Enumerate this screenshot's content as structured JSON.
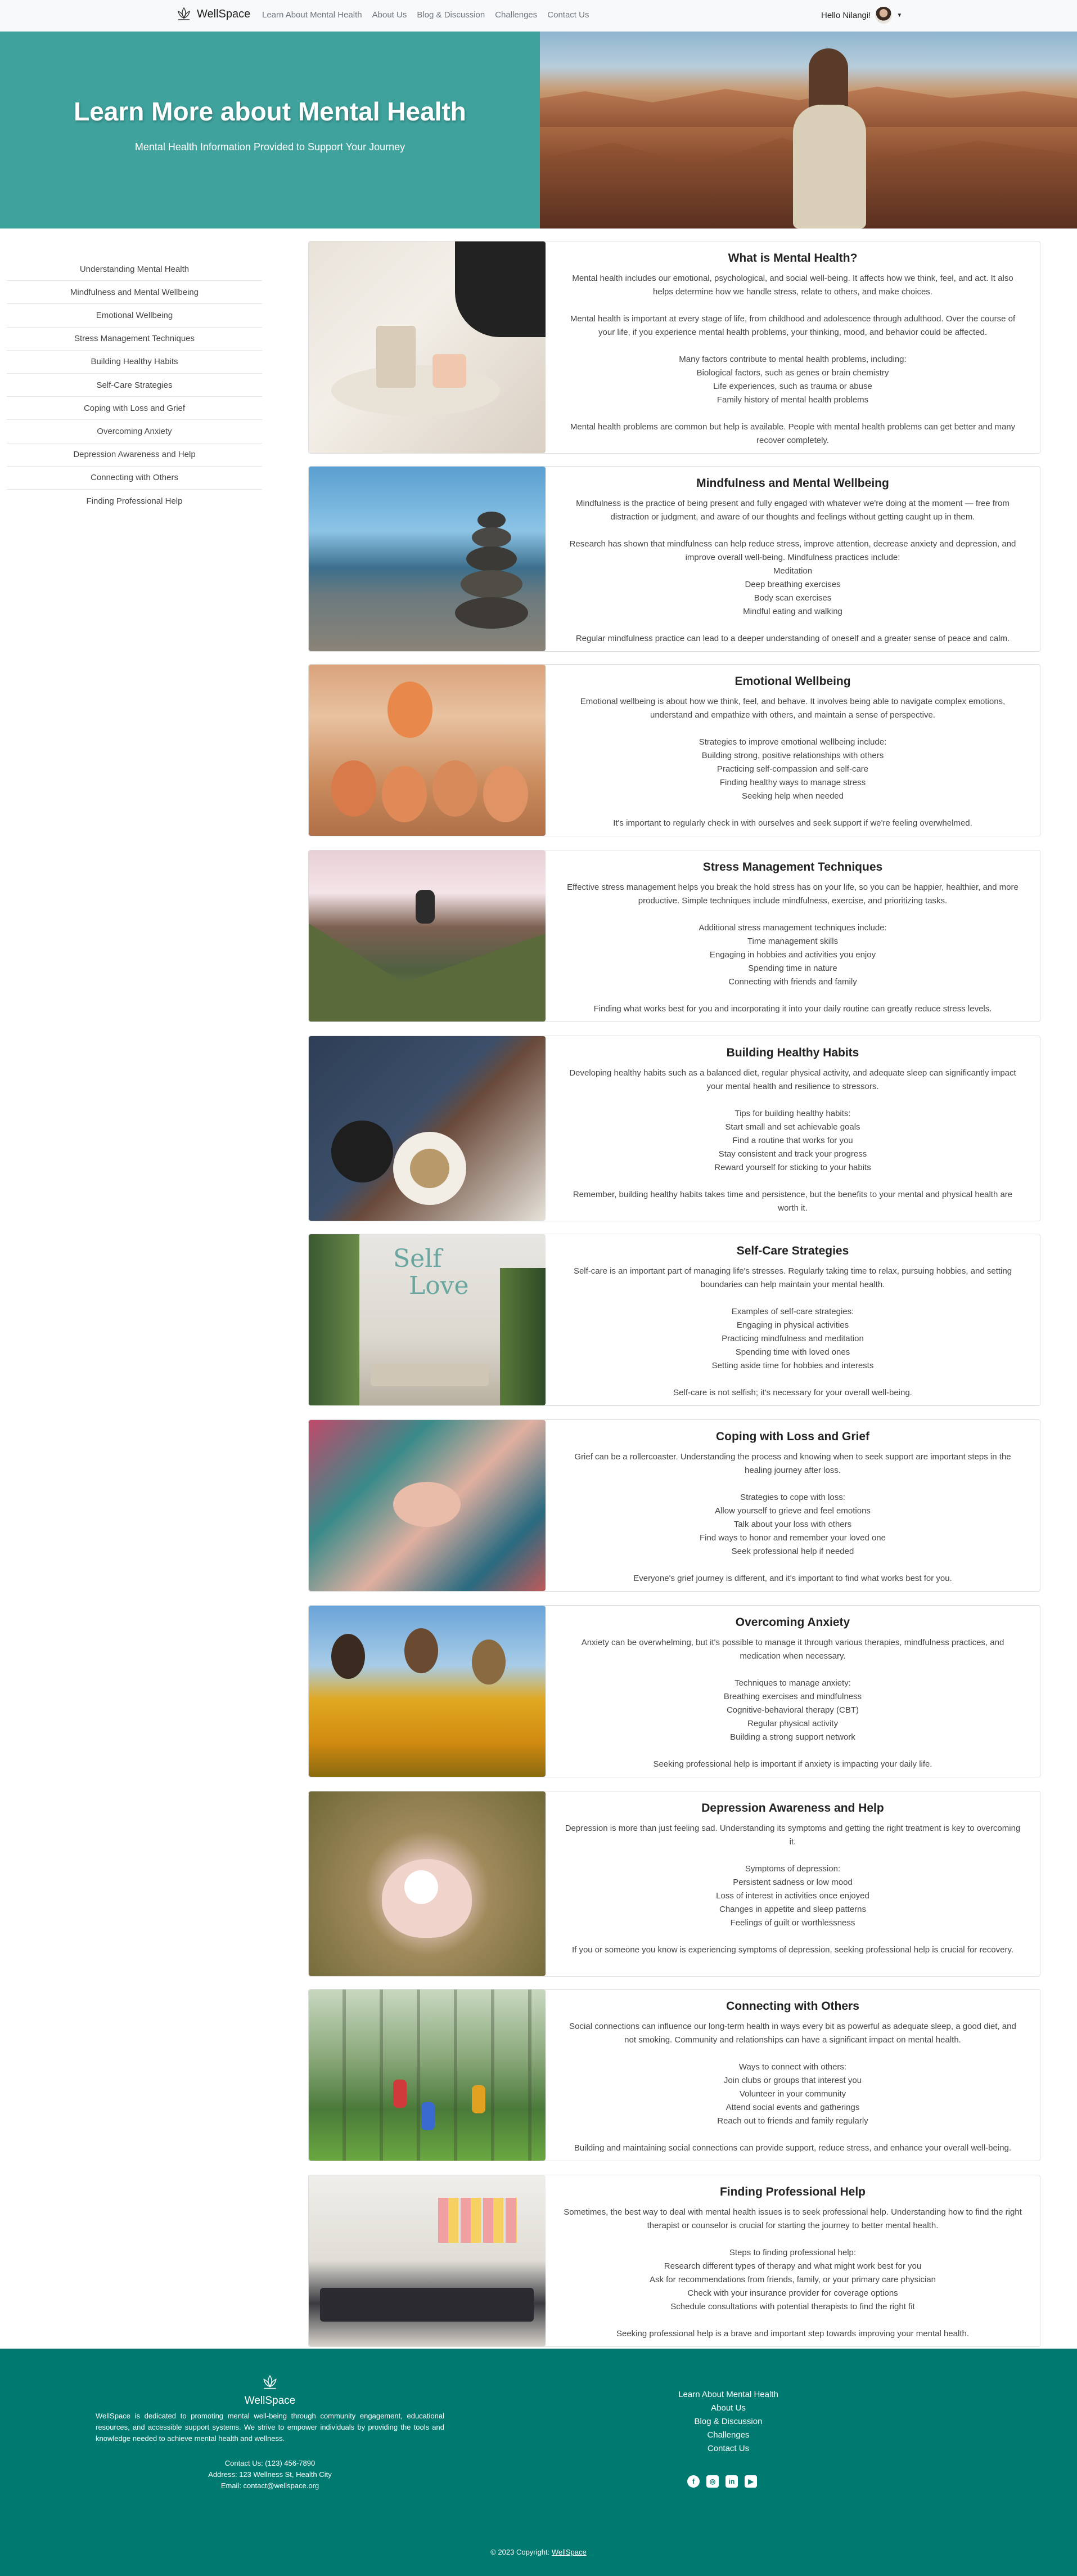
{
  "nav": {
    "brand": "WellSpace",
    "links": [
      "Learn About Mental Health",
      "About Us",
      "Blog & Discussion",
      "Challenges",
      "Contact Us"
    ],
    "greeting": "Hello Nilangi!"
  },
  "hero": {
    "title": "Learn More about Mental Health",
    "subtitle": "Mental Health Information Provided to Support Your Journey"
  },
  "sidebar": [
    "Understanding Mental Health",
    "Mindfulness and Mental Wellbeing",
    "Emotional Wellbeing",
    "Stress Management Techniques",
    "Building Healthy Habits",
    "Self-Care Strategies",
    "Coping with Loss and Grief",
    "Overcoming Anxiety",
    "Depression Awareness and Help",
    "Connecting with Others",
    "Finding Professional Help"
  ],
  "cards": [
    {
      "title": "What is Mental Health?",
      "intro": "Mental health includes our emotional, psychological, and social well-being. It affects how we think, feel, and act. It also helps determine how we handle stress, relate to others, and make choices.",
      "para2": "Mental health is important at every stage of life, from childhood and adolescence through adulthood. Over the course of your life, if you experience mental health problems, your thinking, mood, and behavior could be affected.",
      "list": [
        "Many factors contribute to mental health problems, including:",
        "Biological factors, such as genes or brain chemistry",
        "Life experiences, such as trauma or abuse",
        "Family history of mental health problems"
      ],
      "outro": "Mental health problems are common but help is available. People with mental health problems can get better and many recover completely."
    },
    {
      "title": "Mindfulness and Mental Wellbeing",
      "intro": "Mindfulness is the practice of being present and fully engaged with whatever we're doing at the moment — free from distraction or judgment, and aware of our thoughts and feelings without getting caught up in them.",
      "list": [
        "Research has shown that mindfulness can help reduce stress, improve attention, decrease anxiety and depression, and improve overall well-being. Mindfulness practices include:",
        "Meditation",
        "Deep breathing exercises",
        "Body scan exercises",
        "Mindful eating and walking"
      ],
      "outro": "Regular mindfulness practice can lead to a deeper understanding of oneself and a greater sense of peace and calm."
    },
    {
      "title": "Emotional Wellbeing",
      "intro": "Emotional wellbeing is about how we think, feel, and behave. It involves being able to navigate complex emotions, understand and empathize with others, and maintain a sense of perspective.",
      "list": [
        "Strategies to improve emotional wellbeing include:",
        "Building strong, positive relationships with others",
        "Practicing self-compassion and self-care",
        "Finding healthy ways to manage stress",
        "Seeking help when needed"
      ],
      "outro": "It's important to regularly check in with ourselves and seek support if we're feeling overwhelmed."
    },
    {
      "title": "Stress Management Techniques",
      "intro": "Effective stress management helps you break the hold stress has on your life, so you can be happier, healthier, and more productive. Simple techniques include mindfulness, exercise, and prioritizing tasks.",
      "list": [
        "Additional stress management techniques include:",
        "Time management skills",
        "Engaging in hobbies and activities you enjoy",
        "Spending time in nature",
        "Connecting with friends and family"
      ],
      "outro": "Finding what works best for you and incorporating it into your daily routine can greatly reduce stress levels."
    },
    {
      "title": "Building Healthy Habits",
      "intro": "Developing healthy habits such as a balanced diet, regular physical activity, and adequate sleep can significantly impact your mental health and resilience to stressors.",
      "list": [
        "Tips for building healthy habits:",
        "Start small and set achievable goals",
        "Find a routine that works for you",
        "Stay consistent and track your progress",
        "Reward yourself for sticking to your habits"
      ],
      "outro": "Remember, building healthy habits takes time and persistence, but the benefits to your mental and physical health are worth it."
    },
    {
      "title": "Self-Care Strategies",
      "intro": "Self-care is an important part of managing life's stresses. Regularly taking time to relax, pursuing hobbies, and setting boundaries can help maintain your mental health.",
      "list": [
        "Examples of self-care strategies:",
        "Engaging in physical activities",
        "Practicing mindfulness and meditation",
        "Spending time with loved ones",
        "Setting aside time for hobbies and interests"
      ],
      "outro": "Self-care is not selfish; it's necessary for your overall well-being."
    },
    {
      "title": "Coping with Loss and Grief",
      "intro": "Grief can be a rollercoaster. Understanding the process and knowing when to seek support are important steps in the healing journey after loss.",
      "list": [
        "Strategies to cope with loss:",
        "Allow yourself to grieve and feel emotions",
        "Talk about your loss with others",
        "Find ways to honor and remember your loved one",
        "Seek professional help if needed"
      ],
      "outro": "Everyone's grief journey is different, and it's important to find what works best for you."
    },
    {
      "title": "Overcoming Anxiety",
      "intro": "Anxiety can be overwhelming, but it's possible to manage it through various therapies, mindfulness practices, and medication when necessary.",
      "list": [
        "Techniques to manage anxiety:",
        "Breathing exercises and mindfulness",
        "Cognitive-behavioral therapy (CBT)",
        "Regular physical activity",
        "Building a strong support network"
      ],
      "outro": "Seeking professional help is important if anxiety is impacting your daily life."
    },
    {
      "title": "Depression Awareness and Help",
      "intro": "Depression is more than just feeling sad. Understanding its symptoms and getting the right treatment is key to overcoming it.",
      "list": [
        "Symptoms of depression:",
        "Persistent sadness or low mood",
        "Loss of interest in activities once enjoyed",
        "Changes in appetite and sleep patterns",
        "Feelings of guilt or worthlessness"
      ],
      "outro": "If you or someone you know is experiencing symptoms of depression, seeking professional help is crucial for recovery."
    },
    {
      "title": "Connecting with Others",
      "intro": "Social connections can influence our long-term health in ways every bit as powerful as adequate sleep, a good diet, and not smoking. Community and relationships can have a significant impact on mental health.",
      "list": [
        "Ways to connect with others:",
        "Join clubs or groups that interest you",
        "Volunteer in your community",
        "Attend social events and gatherings",
        "Reach out to friends and family regularly"
      ],
      "outro": "Building and maintaining social connections can provide support, reduce stress, and enhance your overall well-being."
    },
    {
      "title": "Finding Professional Help",
      "intro": "Sometimes, the best way to deal with mental health issues is to seek professional help. Understanding how to find the right therapist or counselor is crucial for starting the journey to better mental health.",
      "list": [
        "Steps to finding professional help:",
        "Research different types of therapy and what might work best for you",
        "Ask for recommendations from friends, family, or your primary care physician",
        "Check with your insurance provider for coverage options",
        "Schedule consultations with potential therapists to find the right fit"
      ],
      "outro": "Seeking professional help is a brave and important step towards improving your mental health."
    }
  ],
  "footer": {
    "brand": "WellSpace",
    "description": "WellSpace is dedicated to promoting mental well-being through community engagement, educational resources, and accessible support systems. We strive to empower individuals by providing the tools and knowledge needed to achieve mental health and wellness.",
    "phone": "Contact Us: (123) 456-7890",
    "address": "Address: 123 Wellness St, Health City",
    "email": "Email: contact@wellspace.org",
    "links": [
      "Learn About Mental Health",
      "About Us",
      "Blog & Discussion",
      "Challenges",
      "Contact Us"
    ],
    "social": [
      "facebook-icon",
      "instagram-icon",
      "linkedin-icon",
      "youtube-icon"
    ],
    "copyright": "© 2023 Copyright:",
    "copyright_link": "WellSpace"
  },
  "colors": {
    "hero": "#3fa29c",
    "footer": "#007a70",
    "navbar": "#f8f9fa"
  }
}
